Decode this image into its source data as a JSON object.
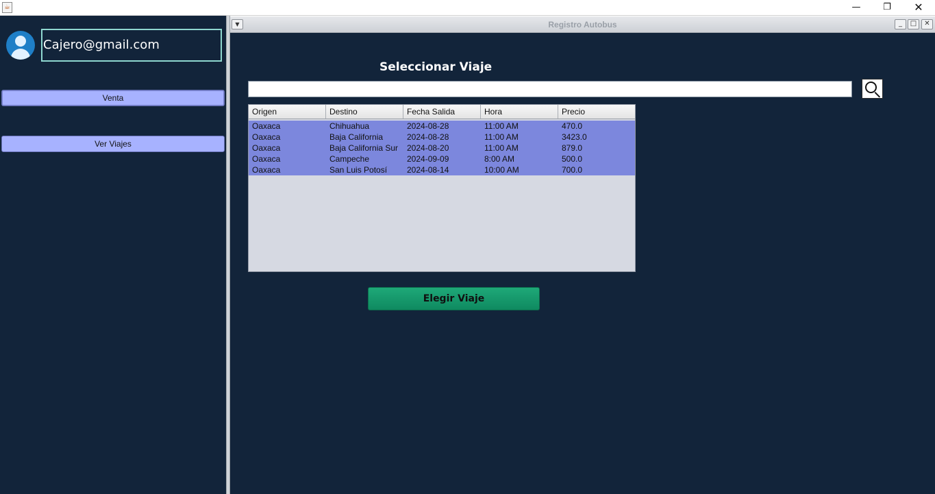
{
  "window": {
    "app_icon": "java-icon",
    "controls": {
      "minimize": "—",
      "restore": "❐",
      "close": "✕"
    }
  },
  "sidebar": {
    "user_email": "Cajero@gmail.com",
    "buttons": [
      {
        "label": "Venta"
      },
      {
        "label": "Ver Viajes"
      }
    ]
  },
  "internal_frame": {
    "title": "Registro Autobus",
    "heading": "Seleccionar Viaje",
    "search": {
      "value": "",
      "placeholder": ""
    },
    "table": {
      "columns": [
        "Origen",
        "Destino",
        "Fecha Salida",
        "Hora",
        "Precio"
      ],
      "rows": [
        [
          "Oaxaca",
          "Chihuahua",
          "2024-08-28",
          "11:00 AM",
          "470.0"
        ],
        [
          "Oaxaca",
          "Baja California",
          "2024-08-28",
          "11:00 AM",
          "3423.0"
        ],
        [
          "Oaxaca",
          "Baja California Sur",
          "2024-08-20",
          "11:00 AM",
          "879.0"
        ],
        [
          "Oaxaca",
          "Campeche",
          "2024-09-09",
          "8:00 AM",
          "500.0"
        ],
        [
          "Oaxaca",
          "San Luis Potosí",
          "2024-08-14",
          "10:00 AM",
          "700.0"
        ]
      ]
    },
    "choose_button": "Elegir Viaje"
  },
  "colors": {
    "background": "#12243a",
    "sidebar_button": "#a7b2ff",
    "selected_rows": "#7c87dd",
    "choose_button": "#15986a",
    "email_border": "#8fd8d0"
  }
}
